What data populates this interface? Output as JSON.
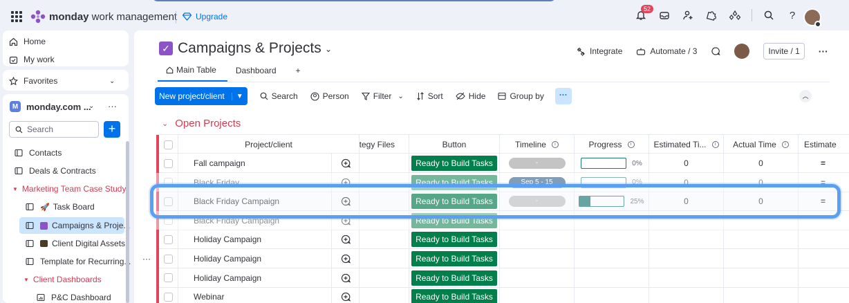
{
  "topbar": {
    "brand_bold": "monday",
    "brand_rest": " work management",
    "upgrade": "Upgrade",
    "notifications_count": "52"
  },
  "sidebar": {
    "home": "Home",
    "my_work": "My work",
    "favorites": "Favorites",
    "workspace_initial": "M",
    "workspace": "monday.com ...",
    "search_placeholder": "Search",
    "items": [
      {
        "label": "Contacts"
      },
      {
        "label": "Deals & Contracts"
      },
      {
        "label": "Marketing Team Case Study"
      },
      {
        "label": "Task Board"
      },
      {
        "label": "Campaigns & Proje..."
      },
      {
        "label": "Client Digital Assets"
      },
      {
        "label": "Template for Recurring..."
      },
      {
        "label": "Client Dashboards"
      },
      {
        "label": "P&C Dashboard"
      }
    ]
  },
  "board": {
    "title": "Campaigns & Projects",
    "integrate": "Integrate",
    "automate": "Automate / 3",
    "invite": "Invite / 1",
    "tabs": [
      {
        "label": "Main Table"
      },
      {
        "label": "Dashboard"
      },
      {
        "label": "+"
      }
    ]
  },
  "toolbar": {
    "new_item": "New project/client",
    "search": "Search",
    "person": "Person",
    "filter": "Filter",
    "sort": "Sort",
    "hide": "Hide",
    "group_by": "Group by",
    "more": "···"
  },
  "group": {
    "title": "Open Projects",
    "columns": {
      "project": "Project/client",
      "files": "ategy Files",
      "button": "Button",
      "timeline": "Timeline",
      "progress": "Progress",
      "estimated": "Estimated Ti...",
      "actual": "Actual Time",
      "estimate_cut": "Estimate"
    },
    "rows": [
      {
        "name": "Fall campaign",
        "button": "Ready to Build Tasks",
        "timeline": "-",
        "progress_label": "0%",
        "progress": 0,
        "estimated": "0",
        "actual": "0"
      },
      {
        "name": "Black Friday",
        "button": "Ready to Build Tasks",
        "timeline": "Sep 5 - 15",
        "progress_label": "0%",
        "progress": 0,
        "estimated": "0",
        "actual": "0"
      },
      {
        "name": "Black Friday Campaign",
        "button": "Ready to Build Tasks",
        "timeline": "-",
        "progress_label": "25%",
        "progress": 25,
        "estimated": "0",
        "actual": "0"
      },
      {
        "name": "Black Friday Campaign",
        "button": "Ready to Build Tasks",
        "timeline": "",
        "progress_label": "",
        "progress": 0,
        "estimated": "",
        "actual": ""
      },
      {
        "name": "Holiday Campaign",
        "button": "Ready to Build Tasks",
        "timeline": "",
        "progress_label": "",
        "progress": 0,
        "estimated": "",
        "actual": ""
      },
      {
        "name": "Holiday Campaign",
        "button": "Ready to Build Tasks",
        "timeline": "",
        "progress_label": "",
        "progress": 0,
        "estimated": "",
        "actual": ""
      },
      {
        "name": "Holiday Campaign",
        "button": "Ready to Build Tasks",
        "timeline": "",
        "progress_label": "",
        "progress": 0,
        "estimated": "",
        "actual": ""
      },
      {
        "name": "Webinar",
        "button": "Ready to Build Tasks",
        "timeline": "",
        "progress_label": "",
        "progress": 0,
        "estimated": "",
        "actual": ""
      }
    ]
  },
  "colors": {
    "accent": "#0073ea",
    "group": "#d83a52",
    "button_green": "#037f4c",
    "progress_teal": "#1f7a73",
    "highlight": "#5b9ff0"
  }
}
